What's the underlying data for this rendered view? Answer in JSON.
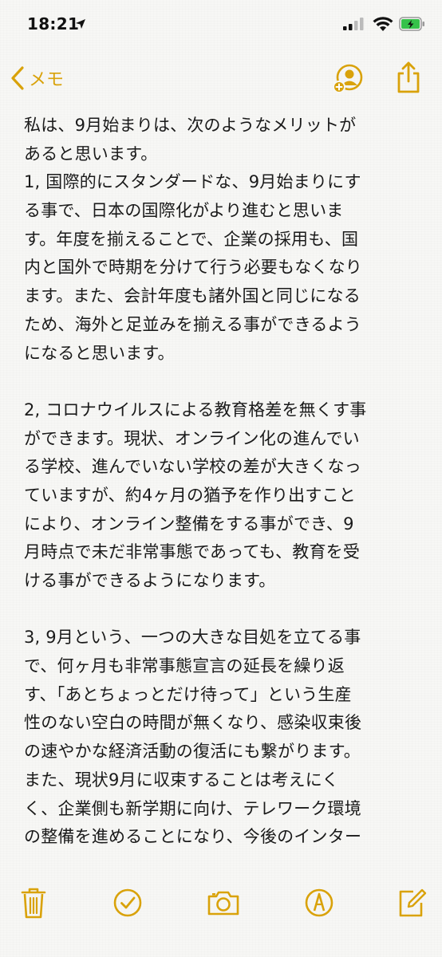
{
  "status_bar": {
    "time": "18:21",
    "icons": [
      "location-arrow-icon",
      "cellular-signal-icon",
      "wifi-icon",
      "battery-charging-icon"
    ]
  },
  "nav": {
    "back_label": "メモ",
    "back_icon": "chevron-left-icon",
    "actions": [
      "add-person-icon",
      "share-icon"
    ],
    "accent_color": "#d9a20a"
  },
  "note": {
    "lines": [
      "私は、9月始まりは、次のようなメリットが",
      "あると思います。",
      "1, 国際的にスタンダードな、9月始まりにす",
      "る事で、日本の国際化がより進むと思いま",
      "す。年度を揃えることで、企業の採用も、国",
      "内と国外で時期を分けて行う必要もなくなり",
      "ます。また、会計年度も諸外国と同じになる",
      "ため、海外と足並みを揃える事ができるよう",
      "になると思います。",
      "",
      "2, コロナウイルスによる教育格差を無くす事",
      "ができます。現状、オンライン化の進んでい",
      "る学校、進んでいない学校の差が大きくなっ",
      "ていますが、約4ヶ月の猶予を作り出すこと",
      "により、オンライン整備をする事ができ、9",
      "月時点で未だ非常事態であっても、教育を受",
      "ける事ができるようになります。",
      "",
      "3, 9月という、一つの大きな目処を立てる事",
      "で、何ヶ月も非常事態宣言の延長を繰り返",
      "す、「あとちょっとだけ待って」という生産",
      "性のない空白の時間が無くなり、感染収束後",
      "の速やかな経済活動の復活にも繋がります。",
      "また、現状9月に収束することは考えにく",
      "く、企業側も新学期に向け、テレワーク環境",
      "の整備を進めることになり、今後のインター"
    ]
  },
  "toolbar": {
    "icons": [
      "trash-icon",
      "checklist-icon",
      "camera-icon",
      "markup-icon",
      "compose-icon"
    ]
  }
}
